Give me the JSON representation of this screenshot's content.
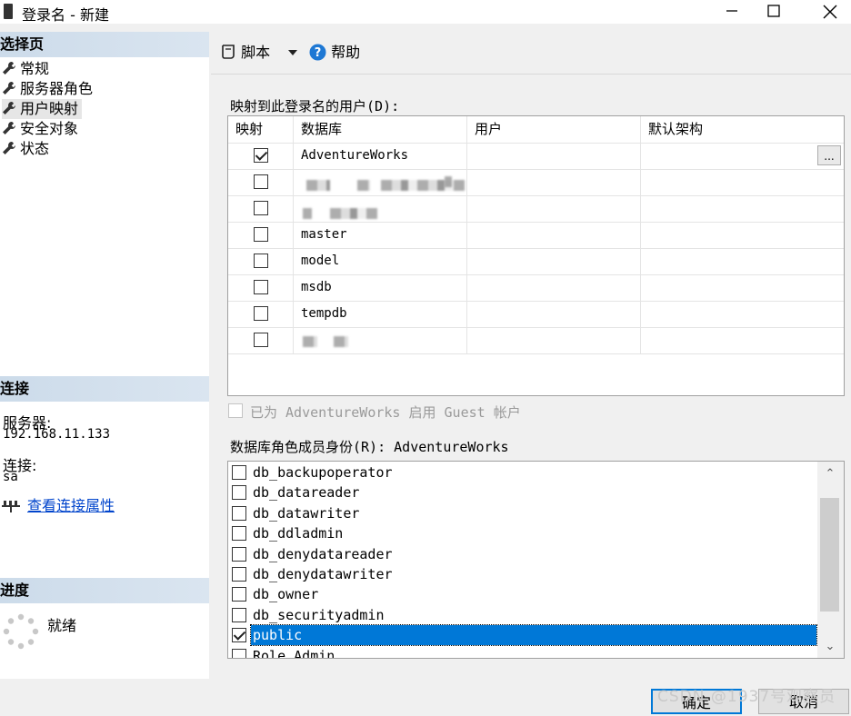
{
  "window": {
    "title": "登录名 - 新建",
    "min_label": "—",
    "max_label": "☐",
    "close_label": "✕"
  },
  "left": {
    "select_page_header": "选择页",
    "nav": [
      {
        "label": "常规"
      },
      {
        "label": "服务器角色"
      },
      {
        "label": "用户映射"
      },
      {
        "label": "安全对象"
      },
      {
        "label": "状态"
      }
    ],
    "connection_header": "连接",
    "server_label": "服务器:",
    "server_value": "192.168.11.133",
    "connection_label": "连接:",
    "connection_value": "sa",
    "view_props_link": "查看连接属性",
    "progress_header": "进度",
    "progress_status": "就绪"
  },
  "toolbar": {
    "script_label": "脚本",
    "help_label": "帮助"
  },
  "mapping": {
    "caption": "映射到此登录名的用户(D):",
    "columns": [
      "映射",
      "数据库",
      "用户",
      "默认架构"
    ],
    "rows": [
      {
        "checked": true,
        "db": "AdventureWorks",
        "ellipsis": "..."
      },
      {
        "checked": false,
        "db": ""
      },
      {
        "checked": false,
        "db": ""
      },
      {
        "checked": false,
        "db": "master"
      },
      {
        "checked": false,
        "db": "model"
      },
      {
        "checked": false,
        "db": "msdb"
      },
      {
        "checked": false,
        "db": "tempdb"
      },
      {
        "checked": false,
        "db": ""
      }
    ]
  },
  "guest_label": "已为 AdventureWorks 启用 Guest 帐户",
  "roles": {
    "caption": "数据库角色成员身份(R): AdventureWorks",
    "items": [
      {
        "name": "db_backupoperator",
        "checked": false
      },
      {
        "name": "db_datareader",
        "checked": false
      },
      {
        "name": "db_datawriter",
        "checked": false
      },
      {
        "name": "db_ddladmin",
        "checked": false
      },
      {
        "name": "db_denydatareader",
        "checked": false
      },
      {
        "name": "db_denydatawriter",
        "checked": false
      },
      {
        "name": "db_owner",
        "checked": false
      },
      {
        "name": "db_securityadmin",
        "checked": false
      },
      {
        "name": "public",
        "checked": true,
        "selected": true
      },
      {
        "name": "Role_Admin",
        "checked": false
      }
    ]
  },
  "buttons": {
    "ok": "确定",
    "cancel": "取消"
  },
  "watermark": "CSDN @1937号观察员"
}
